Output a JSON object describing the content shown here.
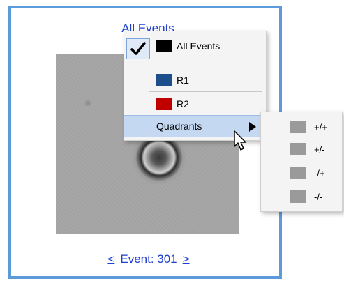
{
  "panel": {
    "title": "All Events",
    "event_nav": {
      "prev": "<",
      "label": "Event: 301",
      "next": ">"
    }
  },
  "menu": {
    "items": [
      {
        "label": "All Events",
        "checked": true,
        "color": "#000000"
      },
      {
        "label": "R1",
        "color": "#1f4e8c"
      },
      {
        "label": "R2",
        "color": "#c00000"
      },
      {
        "label": "Quadrants",
        "has_submenu": true,
        "highlighted": true
      }
    ]
  },
  "submenu": {
    "items": [
      {
        "label": "+/+",
        "color": "#9a9a9a"
      },
      {
        "label": "+/-",
        "color": "#9a9a9a"
      },
      {
        "label": "-/+",
        "color": "#9a9a9a"
      },
      {
        "label": "-/-",
        "color": "#9a9a9a"
      }
    ]
  },
  "icons": {
    "check": "check-icon",
    "arrow": "submenu-arrow-icon",
    "cursor": "mouse-cursor-icon"
  }
}
